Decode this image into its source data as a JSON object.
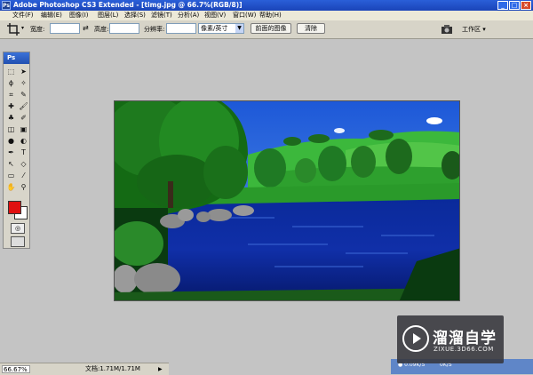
{
  "window": {
    "title": "Adobe Photoshop CS3 Extended - [timg.jpg @ 66.7%(RGB/8)]",
    "app_icon_text": "Ps",
    "controls": [
      "_",
      "□",
      "×"
    ]
  },
  "menu": [
    "文件(F)",
    "编辑(E)",
    "图像(I)",
    "图层(L)",
    "选择(S)",
    "滤镜(T)",
    "分析(A)",
    "视图(V)",
    "窗口(W)",
    "帮助(H)"
  ],
  "options": {
    "tool_icon": "crop-icon",
    "width_label": "宽度:",
    "swap_symbol": "⇄",
    "height_label": "高度:",
    "resolution_label": "分辨率:",
    "unit_select": "像素/英寸",
    "front_image_button": "前面的图像",
    "clear_button": "清除",
    "workspace_label": "工作区 ▾",
    "width_value": "",
    "height_value": "",
    "resolution_value": ""
  },
  "toolbox": {
    "title": "Ps",
    "tools": [
      {
        "glyph": "⬚",
        "icon": "marquee-icon"
      },
      {
        "glyph": "➤",
        "icon": "move-icon"
      },
      {
        "glyph": "ϕ",
        "icon": "lasso-icon"
      },
      {
        "glyph": "✧",
        "icon": "magic-wand-icon"
      },
      {
        "glyph": "⌗",
        "icon": "crop-tool-icon"
      },
      {
        "glyph": "✎",
        "icon": "slice-icon"
      },
      {
        "glyph": "✚",
        "icon": "healing-brush-icon"
      },
      {
        "glyph": "🖌",
        "icon": "brush-icon"
      },
      {
        "glyph": "♣",
        "icon": "clone-stamp-icon"
      },
      {
        "glyph": "✐",
        "icon": "history-brush-icon"
      },
      {
        "glyph": "◫",
        "icon": "eraser-icon"
      },
      {
        "glyph": "▣",
        "icon": "gradient-icon"
      },
      {
        "glyph": "●",
        "icon": "blur-icon"
      },
      {
        "glyph": "◐",
        "icon": "dodge-icon"
      },
      {
        "glyph": "✒",
        "icon": "pen-icon"
      },
      {
        "glyph": "T",
        "icon": "type-icon"
      },
      {
        "glyph": "↖",
        "icon": "path-selection-icon"
      },
      {
        "glyph": "◇",
        "icon": "shape-icon"
      },
      {
        "glyph": "▭",
        "icon": "notes-icon"
      },
      {
        "glyph": "⁄",
        "icon": "eyedropper-icon"
      },
      {
        "glyph": "✋",
        "icon": "hand-icon"
      },
      {
        "glyph": "⚲",
        "icon": "zoom-icon"
      }
    ],
    "foreground_color": "#e01010",
    "background_color": "#ffffff"
  },
  "status": {
    "zoom": "66.67%",
    "doc_info": "文档:1.71M/1.71M",
    "arrow": "▶"
  },
  "taskbar": {
    "item1": "● 0.09K/S",
    "item2": "0K/S"
  },
  "watermark": {
    "brand": "溜溜自学",
    "url": "ZIXUE.3D66.COM"
  }
}
